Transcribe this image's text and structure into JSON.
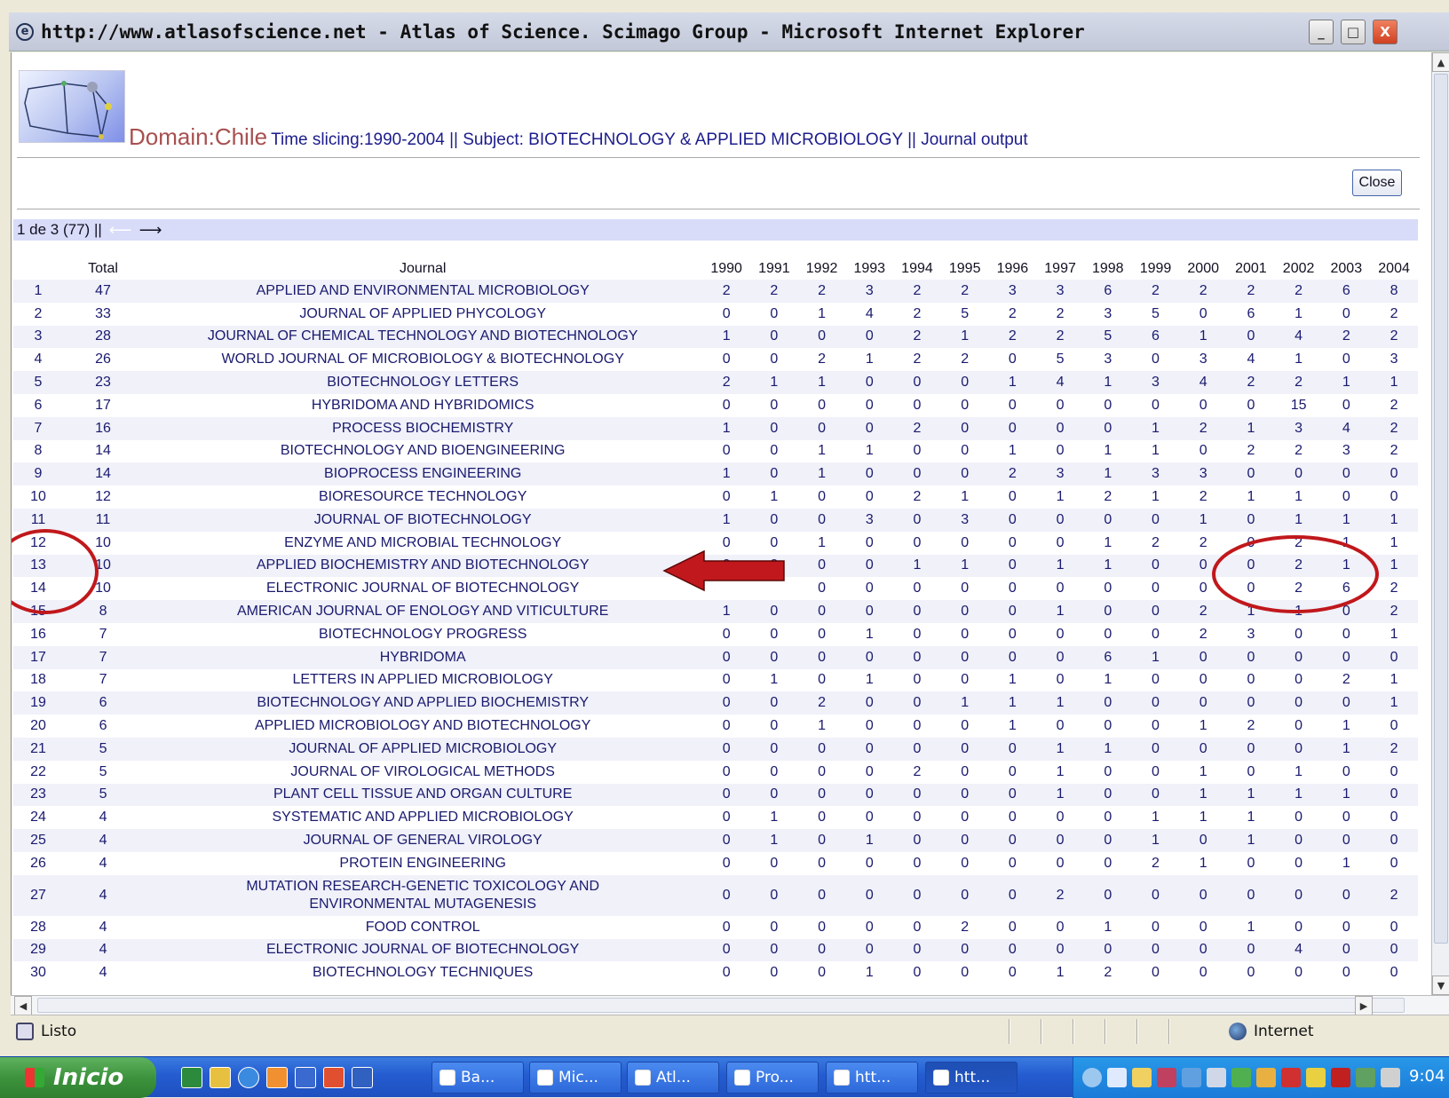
{
  "window": {
    "title": "http://www.atlasofscience.net - Atlas of Science. Scimago Group - Microsoft Internet Explorer",
    "min_glyph": "_",
    "max_glyph": "□",
    "close_glyph": "X"
  },
  "page": {
    "domain_label": "Domain:Chile",
    "subtitle": "Time slicing:1990-2004 || Subject: BIOTECHNOLOGY & APPLIED MICROBIOLOGY || Journal output",
    "close_button": "Close",
    "pager_text": "1 de 3 (77) ||",
    "prev_arrow": "⟵",
    "next_arrow": "⟶"
  },
  "table": {
    "headers": [
      "",
      "Total",
      "Journal",
      "1990",
      "1991",
      "1992",
      "1993",
      "1994",
      "1995",
      "1996",
      "1997",
      "1998",
      "1999",
      "2000",
      "2001",
      "2002",
      "2003",
      "2004"
    ],
    "rows": [
      [
        "1",
        "47",
        "APPLIED AND ENVIRONMENTAL MICROBIOLOGY",
        "2",
        "2",
        "2",
        "3",
        "2",
        "2",
        "3",
        "3",
        "6",
        "2",
        "2",
        "2",
        "2",
        "6",
        "8"
      ],
      [
        "2",
        "33",
        "JOURNAL OF APPLIED PHYCOLOGY",
        "0",
        "0",
        "1",
        "4",
        "2",
        "5",
        "2",
        "2",
        "3",
        "5",
        "0",
        "6",
        "1",
        "0",
        "2"
      ],
      [
        "3",
        "28",
        "JOURNAL OF CHEMICAL TECHNOLOGY AND BIOTECHNOLOGY",
        "1",
        "0",
        "0",
        "0",
        "2",
        "1",
        "2",
        "2",
        "5",
        "6",
        "1",
        "0",
        "4",
        "2",
        "2"
      ],
      [
        "4",
        "26",
        "WORLD JOURNAL OF MICROBIOLOGY & BIOTECHNOLOGY",
        "0",
        "0",
        "2",
        "1",
        "2",
        "2",
        "0",
        "5",
        "3",
        "0",
        "3",
        "4",
        "1",
        "0",
        "3"
      ],
      [
        "5",
        "23",
        "BIOTECHNOLOGY LETTERS",
        "2",
        "1",
        "1",
        "0",
        "0",
        "0",
        "1",
        "4",
        "1",
        "3",
        "4",
        "2",
        "2",
        "1",
        "1"
      ],
      [
        "6",
        "17",
        "HYBRIDOMA AND HYBRIDOMICS",
        "0",
        "0",
        "0",
        "0",
        "0",
        "0",
        "0",
        "0",
        "0",
        "0",
        "0",
        "0",
        "15",
        "0",
        "2"
      ],
      [
        "7",
        "16",
        "PROCESS BIOCHEMISTRY",
        "1",
        "0",
        "0",
        "0",
        "2",
        "0",
        "0",
        "0",
        "0",
        "1",
        "2",
        "1",
        "3",
        "4",
        "2"
      ],
      [
        "8",
        "14",
        "BIOTECHNOLOGY AND BIOENGINEERING",
        "0",
        "0",
        "1",
        "1",
        "0",
        "0",
        "1",
        "0",
        "1",
        "1",
        "0",
        "2",
        "2",
        "3",
        "2"
      ],
      [
        "9",
        "14",
        "BIOPROCESS ENGINEERING",
        "1",
        "0",
        "1",
        "0",
        "0",
        "0",
        "2",
        "3",
        "1",
        "3",
        "3",
        "0",
        "0",
        "0",
        "0"
      ],
      [
        "10",
        "12",
        "BIORESOURCE TECHNOLOGY",
        "0",
        "1",
        "0",
        "0",
        "2",
        "1",
        "0",
        "1",
        "2",
        "1",
        "2",
        "1",
        "1",
        "0",
        "0"
      ],
      [
        "11",
        "11",
        "JOURNAL OF BIOTECHNOLOGY",
        "1",
        "0",
        "0",
        "3",
        "0",
        "3",
        "0",
        "0",
        "0",
        "0",
        "1",
        "0",
        "1",
        "1",
        "1"
      ],
      [
        "12",
        "10",
        "ENZYME AND MICROBIAL TECHNOLOGY",
        "0",
        "0",
        "1",
        "0",
        "0",
        "0",
        "0",
        "0",
        "1",
        "2",
        "2",
        "0",
        "2",
        "1",
        "1"
      ],
      [
        "13",
        "10",
        "APPLIED BIOCHEMISTRY AND BIOTECHNOLOGY",
        "0",
        "2",
        "0",
        "0",
        "1",
        "1",
        "0",
        "1",
        "1",
        "0",
        "0",
        "0",
        "2",
        "1",
        "1"
      ],
      [
        "14",
        "10",
        "ELECTRONIC JOURNAL OF BIOTECHNOLOGY",
        "",
        "",
        "0",
        "0",
        "0",
        "0",
        "0",
        "0",
        "0",
        "0",
        "0",
        "0",
        "2",
        "6",
        "2"
      ],
      [
        "15",
        "8",
        "AMERICAN JOURNAL OF ENOLOGY AND VITICULTURE",
        "1",
        "0",
        "0",
        "0",
        "0",
        "0",
        "0",
        "1",
        "0",
        "0",
        "2",
        "1",
        "1",
        "0",
        "2"
      ],
      [
        "16",
        "7",
        "BIOTECHNOLOGY PROGRESS",
        "0",
        "0",
        "0",
        "1",
        "0",
        "0",
        "0",
        "0",
        "0",
        "0",
        "2",
        "3",
        "0",
        "0",
        "1"
      ],
      [
        "17",
        "7",
        "HYBRIDOMA",
        "0",
        "0",
        "0",
        "0",
        "0",
        "0",
        "0",
        "0",
        "6",
        "1",
        "0",
        "0",
        "0",
        "0",
        "0"
      ],
      [
        "18",
        "7",
        "LETTERS IN APPLIED MICROBIOLOGY",
        "0",
        "1",
        "0",
        "1",
        "0",
        "0",
        "1",
        "0",
        "1",
        "0",
        "0",
        "0",
        "0",
        "2",
        "1"
      ],
      [
        "19",
        "6",
        "BIOTECHNOLOGY AND APPLIED BIOCHEMISTRY",
        "0",
        "0",
        "2",
        "0",
        "0",
        "1",
        "1",
        "1",
        "0",
        "0",
        "0",
        "0",
        "0",
        "0",
        "1"
      ],
      [
        "20",
        "6",
        "APPLIED MICROBIOLOGY AND BIOTECHNOLOGY",
        "0",
        "0",
        "1",
        "0",
        "0",
        "0",
        "1",
        "0",
        "0",
        "0",
        "1",
        "2",
        "0",
        "1",
        "0"
      ],
      [
        "21",
        "5",
        "JOURNAL OF APPLIED MICROBIOLOGY",
        "0",
        "0",
        "0",
        "0",
        "0",
        "0",
        "0",
        "1",
        "1",
        "0",
        "0",
        "0",
        "0",
        "1",
        "2"
      ],
      [
        "22",
        "5",
        "JOURNAL OF VIROLOGICAL METHODS",
        "0",
        "0",
        "0",
        "0",
        "2",
        "0",
        "0",
        "1",
        "0",
        "0",
        "1",
        "0",
        "1",
        "0",
        "0"
      ],
      [
        "23",
        "5",
        "PLANT CELL TISSUE AND ORGAN CULTURE",
        "0",
        "0",
        "0",
        "0",
        "0",
        "0",
        "0",
        "1",
        "0",
        "0",
        "1",
        "1",
        "1",
        "1",
        "0"
      ],
      [
        "24",
        "4",
        "SYSTEMATIC AND APPLIED MICROBIOLOGY",
        "0",
        "1",
        "0",
        "0",
        "0",
        "0",
        "0",
        "0",
        "0",
        "1",
        "1",
        "1",
        "0",
        "0",
        "0"
      ],
      [
        "25",
        "4",
        "JOURNAL OF GENERAL VIROLOGY",
        "0",
        "1",
        "0",
        "1",
        "0",
        "0",
        "0",
        "0",
        "0",
        "1",
        "0",
        "1",
        "0",
        "0",
        "0"
      ],
      [
        "26",
        "4",
        "PROTEIN ENGINEERING",
        "0",
        "0",
        "0",
        "0",
        "0",
        "0",
        "0",
        "0",
        "0",
        "2",
        "1",
        "0",
        "0",
        "1",
        "0"
      ],
      [
        "27",
        "4",
        "MUTATION RESEARCH-GENETIC TOXICOLOGY AND ENVIRONMENTAL MUTAGENESIS",
        "0",
        "0",
        "0",
        "0",
        "0",
        "0",
        "0",
        "2",
        "0",
        "0",
        "0",
        "0",
        "0",
        "0",
        "2"
      ],
      [
        "28",
        "4",
        "FOOD CONTROL",
        "0",
        "0",
        "0",
        "0",
        "0",
        "2",
        "0",
        "0",
        "1",
        "0",
        "0",
        "1",
        "0",
        "0",
        "0"
      ],
      [
        "29",
        "4",
        "ELECTRONIC JOURNAL OF BIOTECHNOLOGY",
        "0",
        "0",
        "0",
        "0",
        "0",
        "0",
        "0",
        "0",
        "0",
        "0",
        "0",
        "0",
        "4",
        "0",
        "0"
      ],
      [
        "30",
        "4",
        "BIOTECHNOLOGY TECHNIQUES",
        "0",
        "0",
        "0",
        "1",
        "0",
        "0",
        "0",
        "1",
        "2",
        "0",
        "0",
        "0",
        "0",
        "0",
        "0"
      ]
    ]
  },
  "annotations": {
    "circle_color": "#c0181c",
    "arrow_color": "#c0181c"
  },
  "statusbar": {
    "text": "Listo",
    "zone": "Internet"
  },
  "taskbar": {
    "start_label": "Inicio",
    "buttons": [
      "Ba...",
      "Mic...",
      "Atl...",
      "Pro...",
      "htt...",
      "htt..."
    ],
    "clock": "9:04"
  }
}
